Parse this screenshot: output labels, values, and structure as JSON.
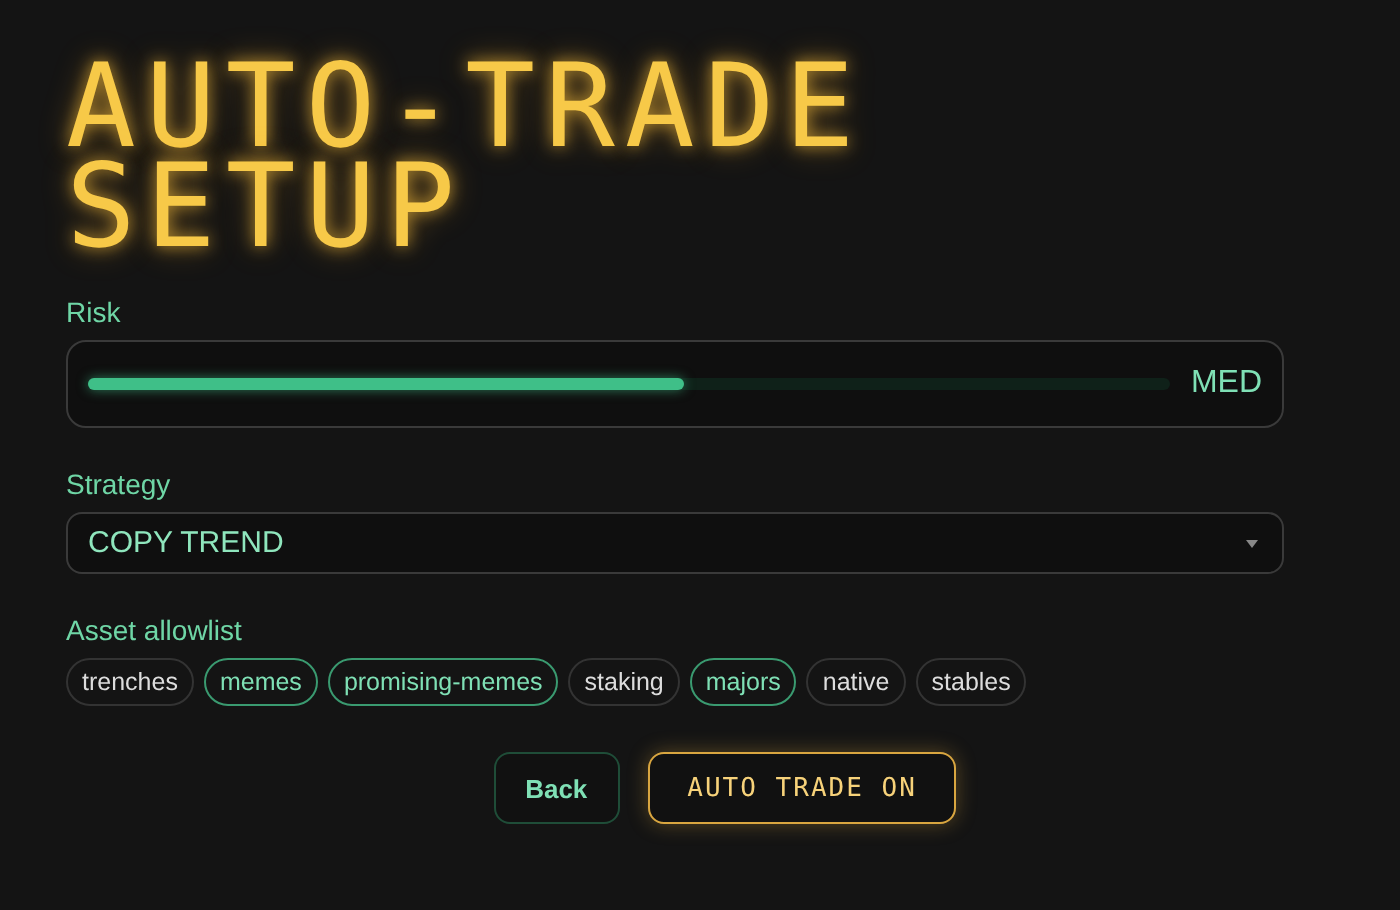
{
  "title": "AUTO-TRADE SETUP",
  "risk": {
    "label": "Risk",
    "level": 0.55,
    "reading": "MED"
  },
  "strategy": {
    "label": "Strategy",
    "value": "COPY TREND"
  },
  "assets": {
    "label": "Asset allowlist",
    "chips": [
      {
        "label": "trenches",
        "selected": false
      },
      {
        "label": "memes",
        "selected": true
      },
      {
        "label": "promising-memes",
        "selected": true
      },
      {
        "label": "staking",
        "selected": false
      },
      {
        "label": "majors",
        "selected": true
      },
      {
        "label": "native",
        "selected": false
      },
      {
        "label": "stables",
        "selected": false
      }
    ]
  },
  "buttons": [
    {
      "label": "Back",
      "kind": "secondary"
    },
    {
      "label": "AUTO TRADE ON",
      "kind": "primary"
    }
  ]
}
